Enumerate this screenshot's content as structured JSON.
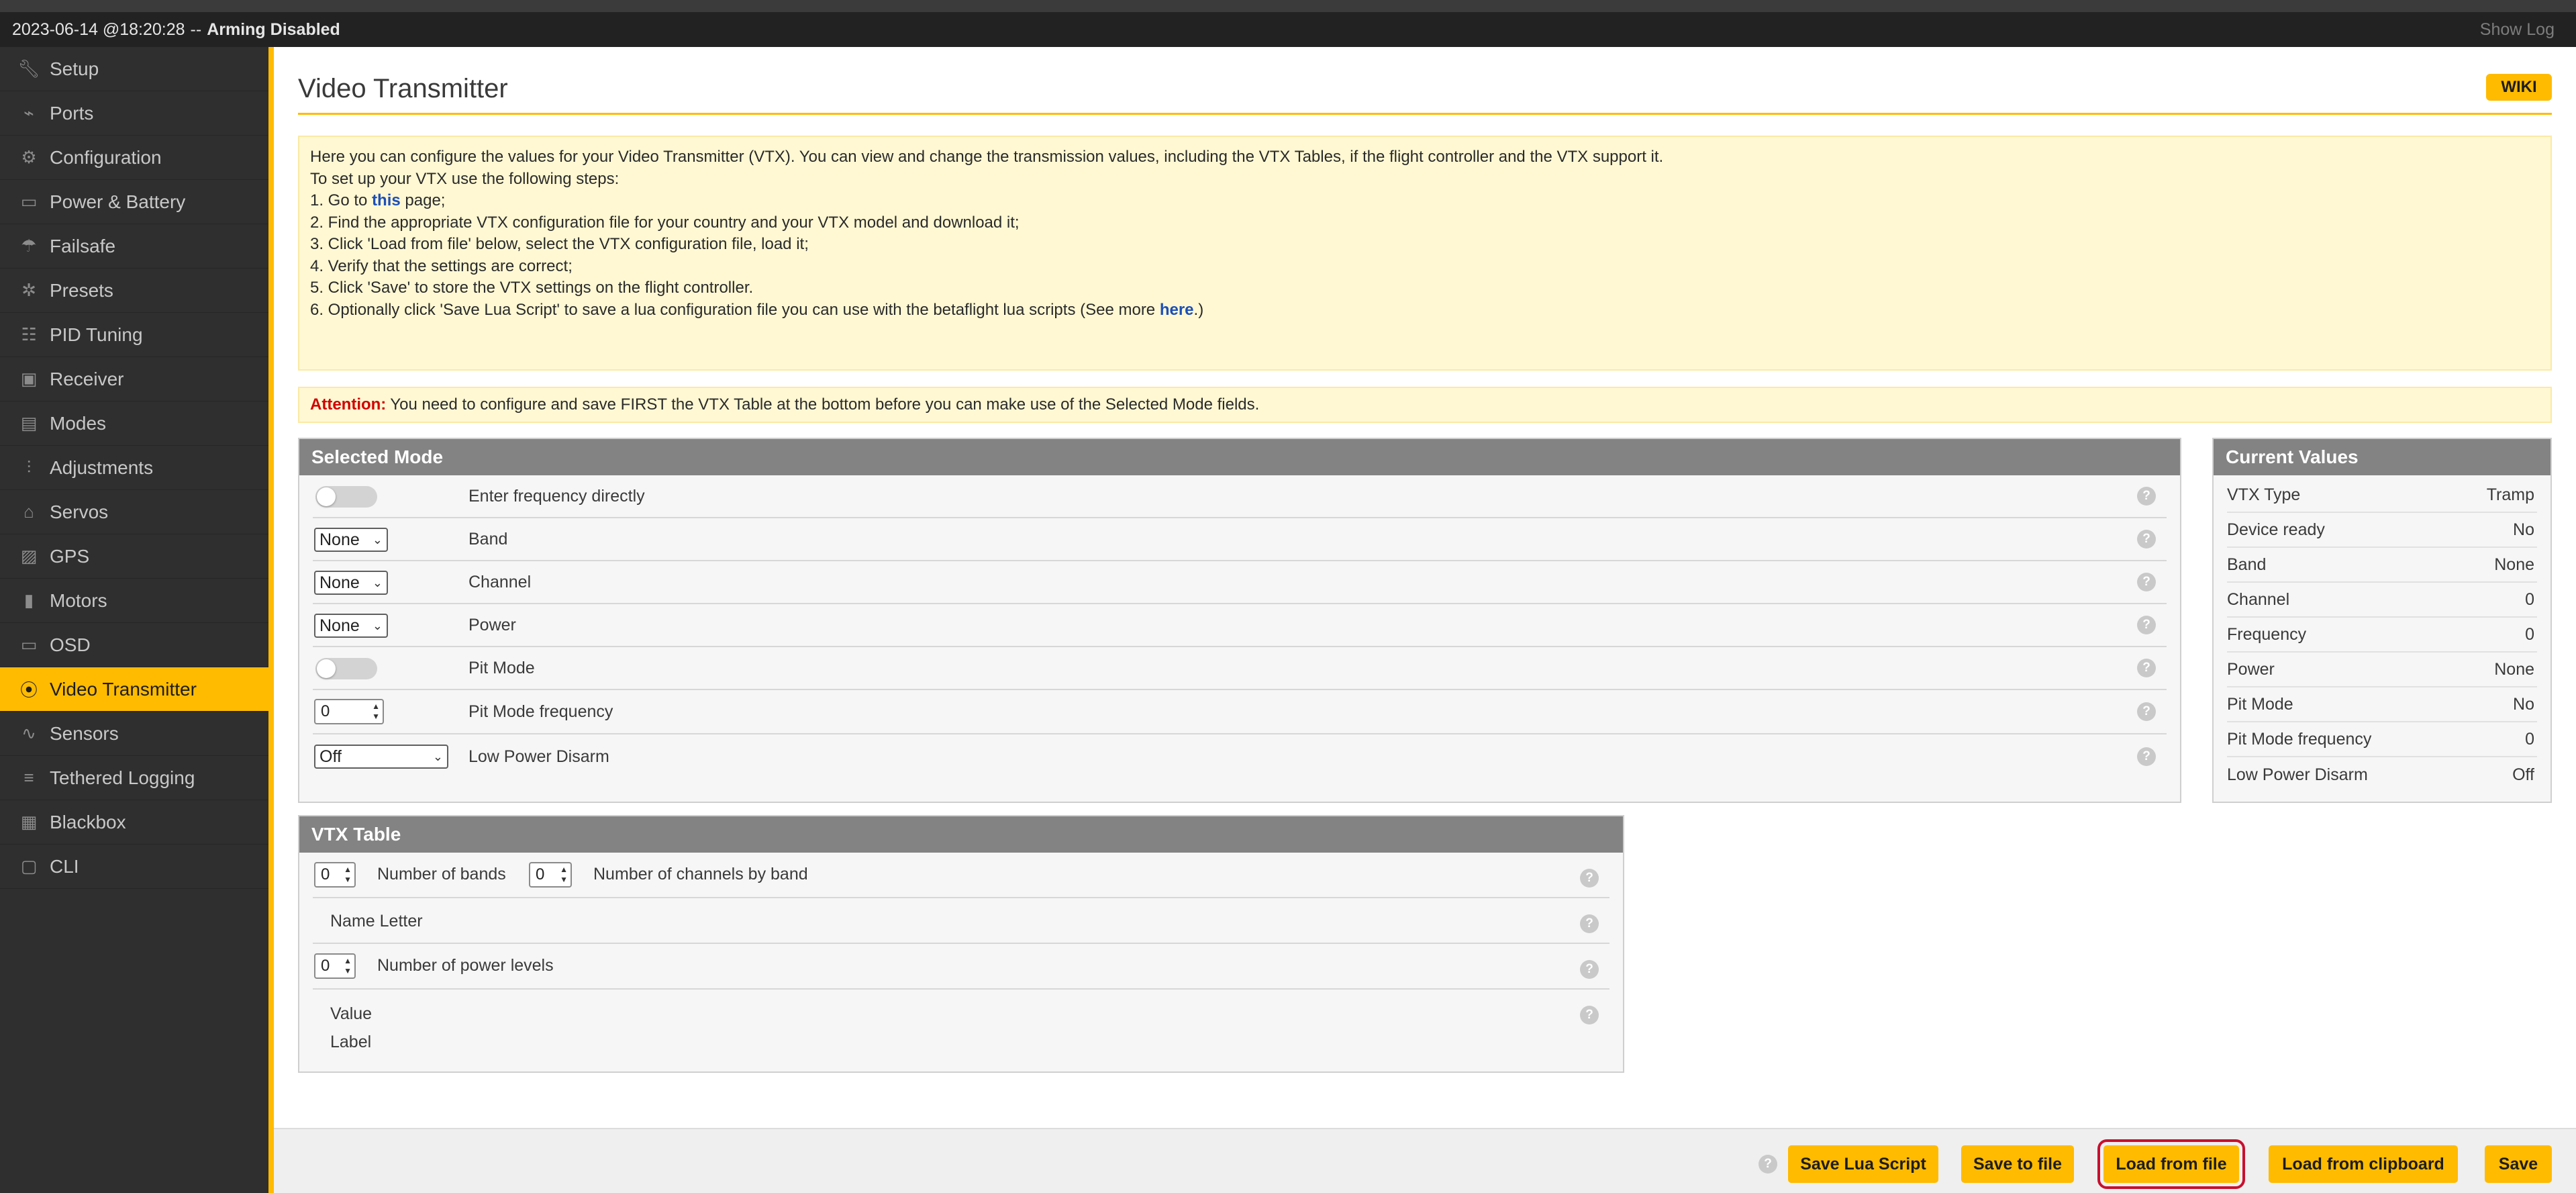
{
  "status": {
    "timestamp": "2023-06-14 @18:20:28",
    "separator": "--",
    "arming": "Arming Disabled",
    "show_log": "Show Log"
  },
  "sidebar": {
    "active_color": "#ffbb00",
    "items": [
      {
        "label": "Setup",
        "icon": "wrench-icon"
      },
      {
        "label": "Ports",
        "icon": "plug-icon"
      },
      {
        "label": "Configuration",
        "icon": "gear-icon"
      },
      {
        "label": "Power & Battery",
        "icon": "battery-icon"
      },
      {
        "label": "Failsafe",
        "icon": "parachute-icon"
      },
      {
        "label": "Presets",
        "icon": "presets-icon"
      },
      {
        "label": "PID Tuning",
        "icon": "pid-icon"
      },
      {
        "label": "Receiver",
        "icon": "receiver-icon"
      },
      {
        "label": "Modes",
        "icon": "modes-icon"
      },
      {
        "label": "Adjustments",
        "icon": "sliders-icon"
      },
      {
        "label": "Servos",
        "icon": "servo-icon"
      },
      {
        "label": "GPS",
        "icon": "gps-icon"
      },
      {
        "label": "Motors",
        "icon": "motor-icon"
      },
      {
        "label": "OSD",
        "icon": "osd-icon"
      },
      {
        "label": "Video Transmitter",
        "icon": "broadcast-icon",
        "active": true
      },
      {
        "label": "Sensors",
        "icon": "pulse-icon"
      },
      {
        "label": "Tethered Logging",
        "icon": "logging-icon"
      },
      {
        "label": "Blackbox",
        "icon": "blackbox-icon"
      },
      {
        "label": "CLI",
        "icon": "terminal-icon"
      }
    ]
  },
  "page": {
    "title": "Video Transmitter",
    "wiki": "WIKI"
  },
  "intro": {
    "line1": "Here you can configure the values for your Video Transmitter (VTX). You can view and change the transmission values, including the VTX Tables, if the flight controller and the VTX support it.",
    "line2": "To set up your VTX use the following steps:",
    "step1_pre": "1. Go to ",
    "step1_link": "this",
    "step1_post": " page;",
    "step2": "2. Find the appropriate VTX configuration file for your country and your VTX model and download it;",
    "step3": "3. Click 'Load from file' below, select the VTX configuration file, load it;",
    "step4": "4. Verify that the settings are correct;",
    "step5": "5. Click 'Save' to store the VTX settings on the flight controller.",
    "step6_pre": "6. Optionally click 'Save Lua Script' to save a lua configuration file you can use with the betaflight lua scripts (See more ",
    "step6_link": "here",
    "step6_post": ".)"
  },
  "attention": {
    "label": "Attention:",
    "text": "You need to configure and save FIRST the VTX Table at the bottom before you can make use of the Selected Mode fields."
  },
  "selected_mode": {
    "title": "Selected Mode",
    "freq_direct_label": "Enter frequency directly",
    "band_value": "None",
    "band_label": "Band",
    "channel_value": "None",
    "channel_label": "Channel",
    "power_value": "None",
    "power_label": "Power",
    "pit_mode_label": "Pit Mode",
    "pit_freq_value": "0",
    "pit_freq_label": "Pit Mode frequency",
    "low_power_value": "Off",
    "low_power_label": "Low Power Disarm"
  },
  "current_values": {
    "title": "Current Values",
    "rows": [
      {
        "label": "VTX Type",
        "value": "Tramp"
      },
      {
        "label": "Device ready",
        "value": "No"
      },
      {
        "label": "Band",
        "value": "None"
      },
      {
        "label": "Channel",
        "value": "0"
      },
      {
        "label": "Frequency",
        "value": "0"
      },
      {
        "label": "Power",
        "value": "None"
      },
      {
        "label": "Pit Mode",
        "value": "No"
      },
      {
        "label": "Pit Mode frequency",
        "value": "0"
      },
      {
        "label": "Low Power Disarm",
        "value": "Off"
      }
    ]
  },
  "vtx_table": {
    "title": "VTX Table",
    "bands_value": "0",
    "bands_label": "Number of bands",
    "channels_value": "0",
    "channels_label": "Number of channels by band",
    "name_letter": "Name Letter",
    "power_levels_value": "0",
    "power_levels_label": "Number of power levels",
    "value_label": "Value",
    "label_label": "Label"
  },
  "toolbar": {
    "save_lua": "Save Lua Script",
    "save_file": "Save to file",
    "load_file": "Load from file",
    "load_clipboard": "Load from clipboard",
    "save": "Save"
  },
  "help_glyph": "?"
}
